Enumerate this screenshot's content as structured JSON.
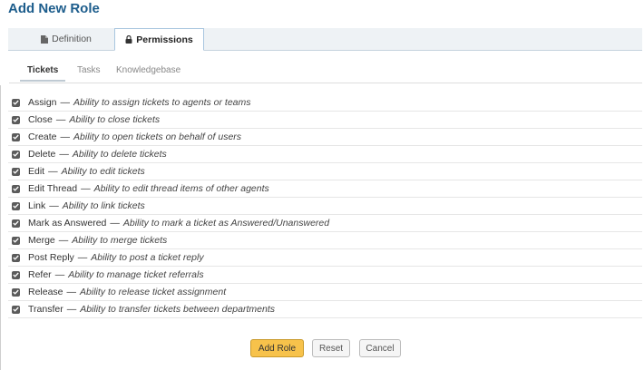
{
  "page": {
    "title": "Add New Role"
  },
  "tabs": [
    {
      "label": "Definition",
      "icon": "document-icon",
      "active": false
    },
    {
      "label": "Permissions",
      "icon": "lock-icon",
      "active": true
    }
  ],
  "subtabs": [
    {
      "label": "Tickets",
      "active": true
    },
    {
      "label": "Tasks",
      "active": false
    },
    {
      "label": "Knowledgebase",
      "active": false
    }
  ],
  "separator": "—",
  "permissions": [
    {
      "name": "Assign",
      "description": "Ability to assign tickets to agents or teams",
      "checked": true
    },
    {
      "name": "Close",
      "description": "Ability to close tickets",
      "checked": true
    },
    {
      "name": "Create",
      "description": "Ability to open tickets on behalf of users",
      "checked": true
    },
    {
      "name": "Delete",
      "description": "Ability to delete tickets",
      "checked": true
    },
    {
      "name": "Edit",
      "description": "Ability to edit tickets",
      "checked": true
    },
    {
      "name": "Edit Thread",
      "description": "Ability to edit thread items of other agents",
      "checked": true
    },
    {
      "name": "Link",
      "description": "Ability to link tickets",
      "checked": true
    },
    {
      "name": "Mark as Answered",
      "description": "Ability to mark a ticket as Answered/Unanswered",
      "checked": true
    },
    {
      "name": "Merge",
      "description": "Ability to merge tickets",
      "checked": true
    },
    {
      "name": "Post Reply",
      "description": "Ability to post a ticket reply",
      "checked": true
    },
    {
      "name": "Refer",
      "description": "Ability to manage ticket referrals",
      "checked": true
    },
    {
      "name": "Release",
      "description": "Ability to release ticket assignment",
      "checked": true
    },
    {
      "name": "Transfer",
      "description": "Ability to transfer tickets between departments",
      "checked": true
    }
  ],
  "buttons": {
    "add_role": "Add Role",
    "reset": "Reset",
    "cancel": "Cancel"
  },
  "colors": {
    "title": "#1d5d8c",
    "primary_button": "#f7c24b",
    "checkbox": "#5b5b5b"
  }
}
